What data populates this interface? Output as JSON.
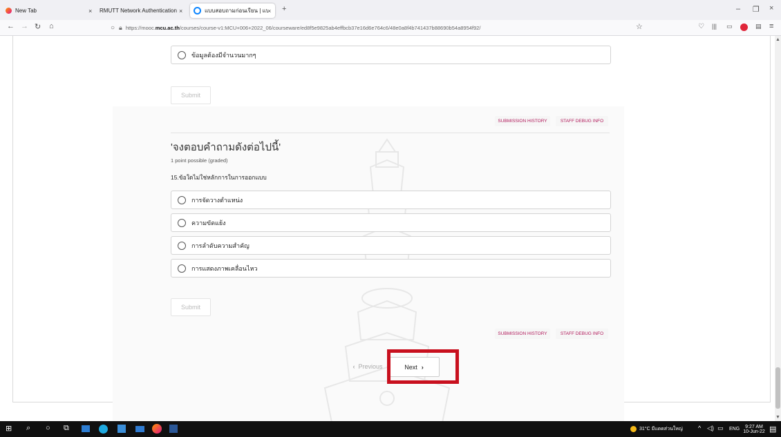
{
  "browser": {
    "tabs": [
      {
        "title": "New Tab",
        "close": "×"
      },
      {
        "title": "RMUTT Network Authentication",
        "close": "×"
      },
      {
        "title": "แบบสอบถามก่อนเรียน | แบบทดส",
        "close": "×"
      }
    ],
    "new_tab": "+",
    "url_prefix": "https://mooc.",
    "url_domain": "mcu.ac.th",
    "url_rest": "/courses/course-v1:MCU+006+2022_06/courseware/ed8f5e9825ab4effbcb37e16d6e764c6/48e0a8f4b741437b88690b54a8954f92/",
    "window_controls": [
      "–",
      "❐",
      "×"
    ]
  },
  "page": {
    "prev_question": {
      "last_option": "ข้อมูลต้องมีจำนวนมากๆ",
      "submit_label": "Submit",
      "submission_history": "SUBMISSION HISTORY",
      "staff_debug": "STAFF DEBUG INFO"
    },
    "question": {
      "heading": "'จงตอบคำถามดังต่อไปนี้'",
      "points": "1 point possible (graded)",
      "text": "15.ข้อใดไม่ใช่หลักการในการออกแบบ",
      "options": [
        "การจัดวางตำแหน่ง",
        "ความขัดแย้ง",
        "การลำดับความสำคัญ",
        "การแสดงภาพเคลื่อนไหว"
      ],
      "submit_label": "Submit",
      "submission_history": "SUBMISSION HISTORY",
      "staff_debug": "STAFF DEBUG INFO"
    },
    "navigation": {
      "previous": "Previous",
      "next": "Next"
    }
  },
  "taskbar": {
    "weather": "31°C มีแดดส่วนใหญ่",
    "language": "ENG",
    "time": "9:27 AM",
    "date": "10-Jun-22"
  }
}
